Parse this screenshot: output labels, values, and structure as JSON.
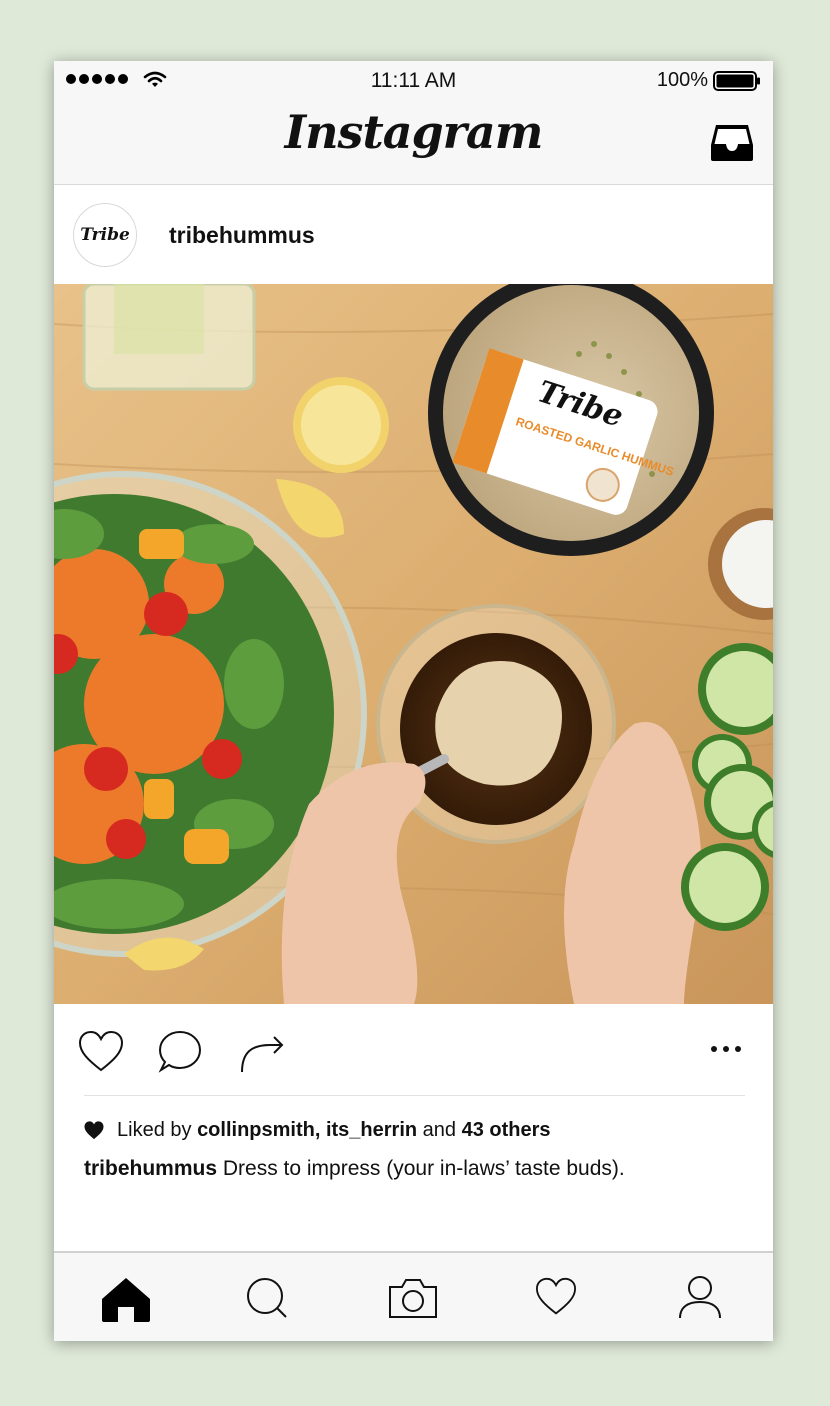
{
  "status_bar": {
    "time": "11:11 AM",
    "battery_percent": "100%",
    "signal_icon": "signal-dots-icon",
    "wifi_icon": "wifi-icon",
    "battery_icon": "battery-full-icon"
  },
  "header": {
    "app_title": "Instagram",
    "inbox_icon": "inbox-tray-icon"
  },
  "post": {
    "avatar_text": "Tribe",
    "username": "tribehummus",
    "image_description_icon": "post-photo",
    "actions": {
      "like_icon": "heart-outline-icon",
      "comment_icon": "comment-bubble-icon",
      "share_icon": "share-arrow-icon",
      "more_icon": "more-dots-icon"
    },
    "likes": {
      "prefix": "Liked by",
      "users": "collinpsmith, its_herrin",
      "conjunction": "and",
      "others": "43 others"
    },
    "caption": {
      "username": "tribehummus",
      "text": "Dress to impress (your in-laws’ taste buds)."
    }
  },
  "product_label": {
    "brand": "Tribe",
    "flavor": "ROASTED GARLIC HUMMUS"
  },
  "tab_bar": {
    "items": [
      "home-icon",
      "search-icon",
      "camera-icon",
      "activity-heart-icon",
      "profile-icon"
    ],
    "active": "home-icon"
  },
  "colors": {
    "background": "#dfe9d8",
    "bar": "#f7f7f7",
    "text": "#111111"
  }
}
